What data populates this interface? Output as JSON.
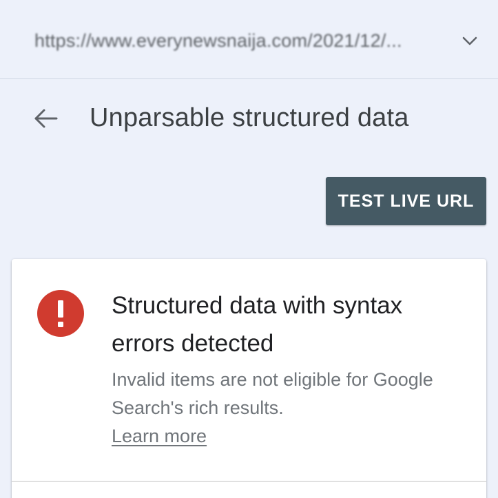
{
  "url_selector": {
    "url": "https://www.everynewsnaija.com/2021/12/...",
    "chevron_icon": "chevron-down-icon"
  },
  "header": {
    "back_icon": "arrow-back-icon",
    "title": "Unparsable structured data"
  },
  "actions": {
    "test_live_url_label": "TEST LIVE URL"
  },
  "card": {
    "status_icon": "error-icon",
    "status_color": "#d03b2f",
    "title": "Structured data with syntax errors detected",
    "description": "Invalid items are not eligible for Google Search's rich results.",
    "learn_more_label": "Learn more"
  },
  "colors": {
    "background": "#edf1fa",
    "button": "#455a64",
    "error": "#d03b2f"
  }
}
